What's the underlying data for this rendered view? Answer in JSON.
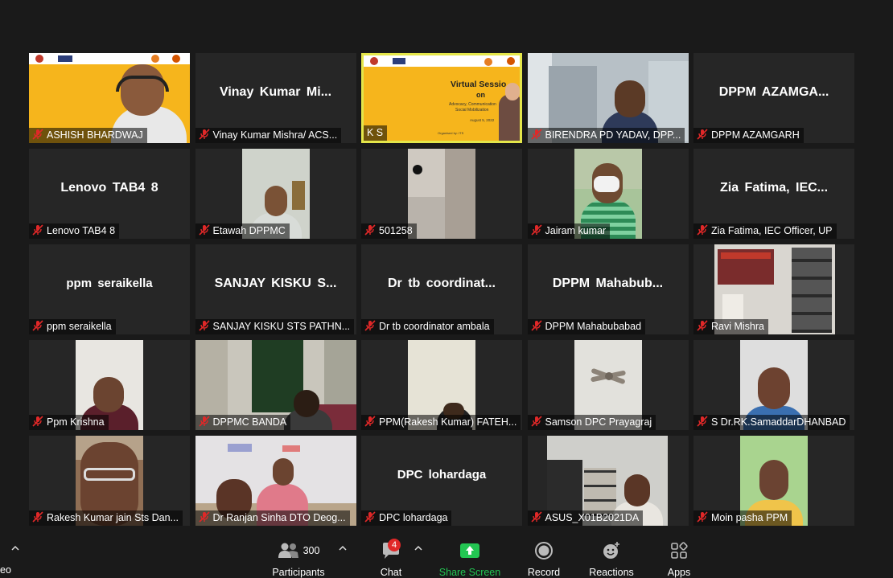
{
  "tiles": [
    {
      "label": "ASHISH BHARDWAJ",
      "center": ""
    },
    {
      "label": "Vinay Kumar Mishra/ ACS...",
      "center": "Vinay Kumar Mi..."
    },
    {
      "label": "K S",
      "center": ""
    },
    {
      "label": "BIRENDRA PD YADAV, DPP...",
      "center": ""
    },
    {
      "label": "DPPM AZAMGARH",
      "center": "DPPM AZAMGA..."
    },
    {
      "label": "Lenovo TAB4 8",
      "center": "Lenovo TAB4 8"
    },
    {
      "label": "Etawah DPPMC",
      "center": ""
    },
    {
      "label": "501258",
      "center": ""
    },
    {
      "label": "Jairam kumar",
      "center": ""
    },
    {
      "label": "Zia Fatima, IEC Officer, UP",
      "center": "Zia Fatima, IEC..."
    },
    {
      "label": "ppm seraikella",
      "center": "ppm seraikella"
    },
    {
      "label": "SANJAY KISKU STS PATHN...",
      "center": "SANJAY KISKU S..."
    },
    {
      "label": "Dr tb coordinator ambala",
      "center": "Dr tb coordinat..."
    },
    {
      "label": "DPPM Mahabubabad",
      "center": "DPPM Mahabub..."
    },
    {
      "label": "Ravi Mishra",
      "center": ""
    },
    {
      "label": "Ppm Krishna",
      "center": ""
    },
    {
      "label": "DPPMC BANDA",
      "center": ""
    },
    {
      "label": "PPM(Rakesh Kumar) FATEH...",
      "center": ""
    },
    {
      "label": "Samson DPC Prayagraj",
      "center": ""
    },
    {
      "label": "S Dr.RK.SamaddarDHANBAD",
      "center": ""
    },
    {
      "label": "Rakesh Kumar jain Sts Dan...",
      "center": ""
    },
    {
      "label": "Dr Ranjan Sinha DTO Deog...",
      "center": ""
    },
    {
      "label": "DPC lohardaga",
      "center": "DPC lohardaga"
    },
    {
      "label": "ASUS_X01B2021DA",
      "center": ""
    },
    {
      "label": "Moin pasha PPM",
      "center": ""
    }
  ],
  "slide": {
    "title": "Virtual Sessio",
    "subtitle_on": "on",
    "line1": "Advocacy, Communication",
    "line2": "Social Mobilization",
    "date": "August 5, 2022",
    "org": "Organised by: ITS"
  },
  "toolbar": {
    "left_partial": "eo",
    "participants_count": "300",
    "participants_label": "Participants",
    "chat_badge": "4",
    "chat_label": "Chat",
    "share_label": "Share Screen",
    "record_label": "Record",
    "reactions_label": "Reactions",
    "apps_label": "Apps"
  },
  "colors": {
    "background": "#1a1a1a",
    "tile": "#262626",
    "active_outline": "#e4e64a",
    "share_green": "#23c552",
    "mic_muted": "#e02828"
  }
}
